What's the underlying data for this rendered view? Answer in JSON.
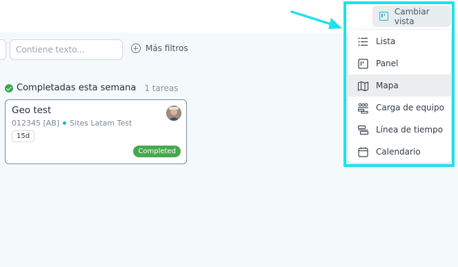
{
  "filters": {
    "search_placeholder": "Contiene texto...",
    "more_filters_label": "Más filtros"
  },
  "group": {
    "title": "Completadas esta semana",
    "count": "1 tareas"
  },
  "task": {
    "title": "Geo test",
    "code": "012345 [AB]",
    "site": "Sites Latam Test",
    "days": "15d",
    "status": "Completed"
  },
  "view_button": {
    "label": "Cambiar vista"
  },
  "view_menu": {
    "items": [
      {
        "label": "Lista",
        "icon": "list-icon"
      },
      {
        "label": "Panel",
        "icon": "panel-icon"
      },
      {
        "label": "Mapa",
        "icon": "map-icon",
        "active": true
      },
      {
        "label": "Carga de equipo",
        "icon": "team-load-icon"
      },
      {
        "label": "Línea de tiempo",
        "icon": "timeline-icon"
      },
      {
        "label": "Calendario",
        "icon": "calendar-icon"
      }
    ]
  },
  "colors": {
    "accent": "#17b3c9",
    "highlight": "#1fe0ec",
    "status_completed": "#46a94f",
    "check_green": "#3aa655",
    "background": "#f4fafb"
  }
}
